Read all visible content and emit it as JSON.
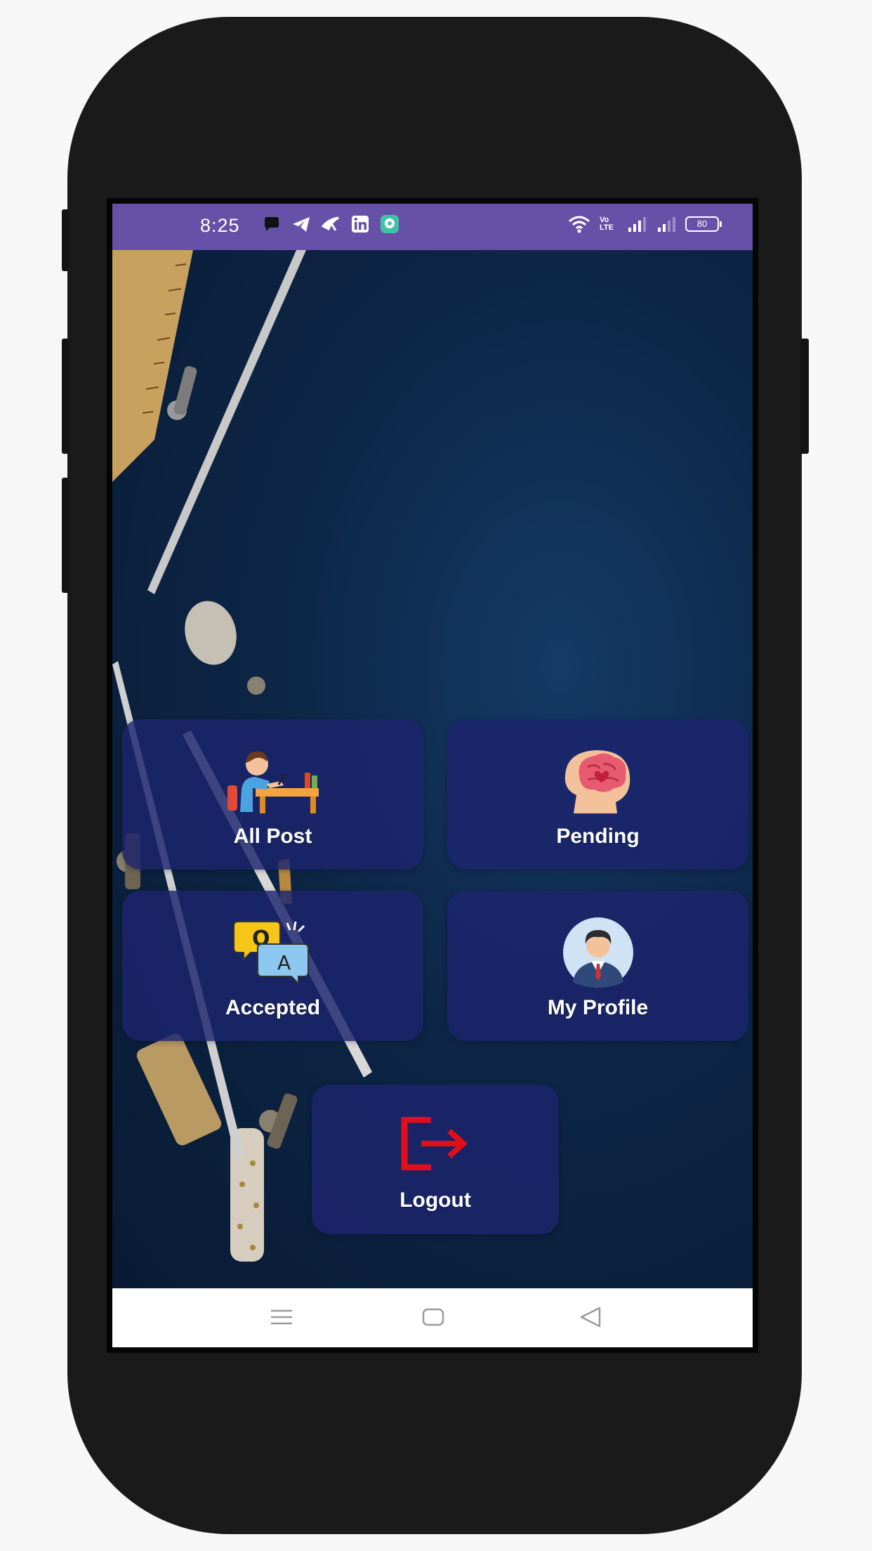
{
  "status_bar": {
    "time": "8:25",
    "battery": "80",
    "volte": "Vo LTE",
    "background": "#6751a8"
  },
  "tiles": {
    "all_post": {
      "label": "All Post",
      "icon": "student-desk-icon"
    },
    "pending": {
      "label": "Pending",
      "icon": "brain-head-icon"
    },
    "accepted": {
      "label": "Accepted",
      "icon": "qa-bubbles-icon"
    },
    "my_profile": {
      "label": "My Profile",
      "icon": "avatar-icon"
    },
    "logout": {
      "label": "Logout",
      "icon": "logout-icon"
    }
  },
  "navigation_bar": {
    "buttons": [
      "menu-icon",
      "home-icon",
      "back-icon"
    ]
  },
  "colors": {
    "tile_background": "#1c246e",
    "logout_icon": "#e0101a",
    "screen_background": "#0e2240"
  }
}
